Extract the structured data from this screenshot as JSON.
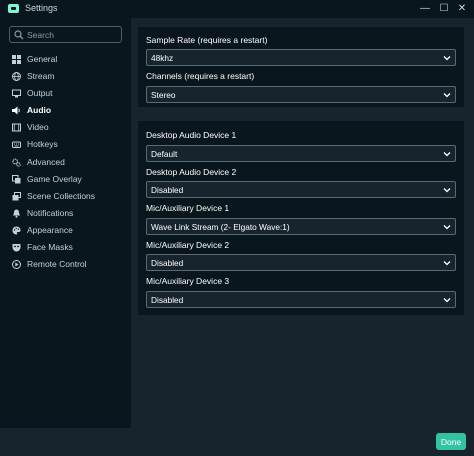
{
  "window": {
    "title": "Settings",
    "minimize_glyph": "—",
    "maximize_glyph": "☐",
    "close_glyph": "✕"
  },
  "search": {
    "placeholder": "Search"
  },
  "sidebar": {
    "items": [
      {
        "label": "General",
        "icon": "grid-icon"
      },
      {
        "label": "Stream",
        "icon": "globe-icon"
      },
      {
        "label": "Output",
        "icon": "monitor-icon"
      },
      {
        "label": "Audio",
        "icon": "speaker-icon",
        "active": true
      },
      {
        "label": "Video",
        "icon": "film-icon"
      },
      {
        "label": "Hotkeys",
        "icon": "keyboard-icon"
      },
      {
        "label": "Advanced",
        "icon": "gears-icon"
      },
      {
        "label": "Game Overlay",
        "icon": "overlay-icon"
      },
      {
        "label": "Scene Collections",
        "icon": "collections-icon"
      },
      {
        "label": "Notifications",
        "icon": "bell-icon"
      },
      {
        "label": "Appearance",
        "icon": "paint-icon"
      },
      {
        "label": "Face Masks",
        "icon": "mask-icon"
      },
      {
        "label": "Remote Control",
        "icon": "remote-icon"
      }
    ]
  },
  "audio": {
    "sample_rate": {
      "label": "Sample Rate (requires a restart)",
      "value": "48khz"
    },
    "channels": {
      "label": "Channels (requires a restart)",
      "value": "Stereo"
    },
    "devices": [
      {
        "label": "Desktop Audio Device 1",
        "value": "Default"
      },
      {
        "label": "Desktop Audio Device 2",
        "value": "Disabled"
      },
      {
        "label": "Mic/Auxiliary Device 1",
        "value": "Wave Link Stream (2- Elgato Wave:1)"
      },
      {
        "label": "Mic/Auxiliary Device 2",
        "value": "Disabled"
      },
      {
        "label": "Mic/Auxiliary Device 3",
        "value": "Disabled"
      }
    ]
  },
  "footer": {
    "done_label": "Done"
  },
  "colors": {
    "accent": "#31c3a2",
    "background": "#17242d",
    "panel": "#09161d",
    "titlebar_icon": "#80f5d2"
  }
}
